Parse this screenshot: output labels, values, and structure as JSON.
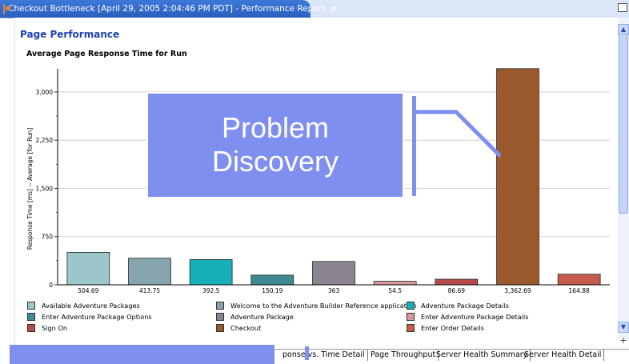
{
  "editor_tab": {
    "title": "Checkout Bottleneck [April 29, 2005 2:04:46 PM PDT] - Performance Report",
    "close_glyph": "✕",
    "icon": "report-doc-icon"
  },
  "page_title": "Page Performance",
  "chart_title": "Average Page Response Time for Run",
  "overlay_label": "Problem\nDiscovery",
  "chart_data": {
    "type": "bar",
    "title": "Average Page Response Time for Run",
    "ylabel": "Response Time [ms] -- Average [for Run]",
    "ylim": [
      0,
      3360
    ],
    "yticks": [
      0,
      750,
      1500,
      2250,
      3000
    ],
    "ytick_labels": [
      "0",
      "750",
      "1,500",
      "2,250",
      "3,000"
    ],
    "grid": true,
    "legend_position": "bottom",
    "values": [
      504.69,
      413.75,
      392.5,
      150.19,
      363,
      54.5,
      86.69,
      3362.69,
      164.88
    ],
    "value_labels": [
      "504.69",
      "413.75",
      "392.5",
      "150.19",
      "363",
      "54.5",
      "86.69",
      "3,362.69",
      "164.88"
    ],
    "colors": [
      "#9cc6c9",
      "#86a4ad",
      "#17b0b8",
      "#3f8a93",
      "#8b8590",
      "#d9979c",
      "#b94a4a",
      "#9b5a2e",
      "#c65b4b"
    ],
    "series_names": [
      "Available Adventure Packages",
      "Enter Adventure Package Options",
      "Sign On",
      "Welcome to the Adventure Builder Reference application",
      "Adventure Package",
      "Checkout",
      "Adventure Package Details",
      "Enter Adventure Package Details",
      "Enter Order Details"
    ],
    "legend": [
      {
        "label": "Available Adventure Packages",
        "color": "#9cc6c9"
      },
      {
        "label": "Welcome to the Adventure Builder Reference application",
        "color": "#86a4ad"
      },
      {
        "label": "Adventure Package Details",
        "color": "#17b0b8"
      },
      {
        "label": "Enter Adventure Package Options",
        "color": "#3f8a93"
      },
      {
        "label": "Adventure Package",
        "color": "#8b8590"
      },
      {
        "label": "Enter Adventure Package Details",
        "color": "#d9979c"
      },
      {
        "label": "Sign On",
        "color": "#b94a4a"
      },
      {
        "label": "Checkout",
        "color": "#9b5a2e"
      },
      {
        "label": "Enter Order Details",
        "color": "#c65b4b"
      }
    ]
  },
  "bottom_tabs": [
    "ponse vs. Time Detail",
    "Page Throughput",
    "Server Health Summary",
    "Server Health Detail"
  ],
  "scroll": {
    "up": "▲",
    "down": "▼",
    "plus": "+"
  }
}
